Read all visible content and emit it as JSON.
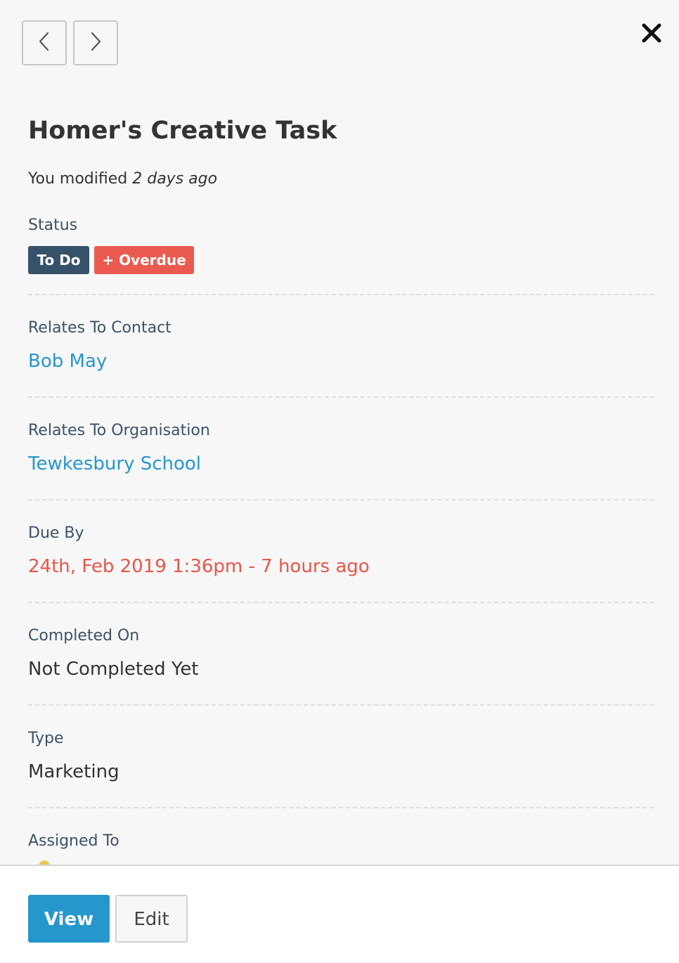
{
  "header": {
    "prev_icon": "chevron-left-icon",
    "next_icon": "chevron-right-icon",
    "close_icon": "close-icon"
  },
  "task": {
    "title": "Homer's Creative Task",
    "modified_prefix": "You modified",
    "modified_time": "2 days ago"
  },
  "status": {
    "label": "Status",
    "badges": [
      {
        "text": "To Do",
        "color": "#36516a"
      },
      {
        "text": "+ Overdue",
        "color": "#ea5a4f"
      }
    ]
  },
  "fields": {
    "contact": {
      "label": "Relates To Contact",
      "value": "Bob May"
    },
    "organisation": {
      "label": "Relates To Organisation",
      "value": "Tewkesbury School"
    },
    "due": {
      "label": "Due By",
      "value": "24th, Feb 2019 1:36pm - 7 hours ago"
    },
    "completed": {
      "label": "Completed On",
      "value": "Not Completed Yet"
    },
    "type": {
      "label": "Type",
      "value": "Marketing"
    },
    "assigned": {
      "label": "Assigned To"
    }
  },
  "footer": {
    "view_label": "View",
    "edit_label": "Edit"
  },
  "colors": {
    "link": "#2597cc",
    "due": "#e8564a",
    "label": "#3b5266",
    "text": "#333333"
  }
}
